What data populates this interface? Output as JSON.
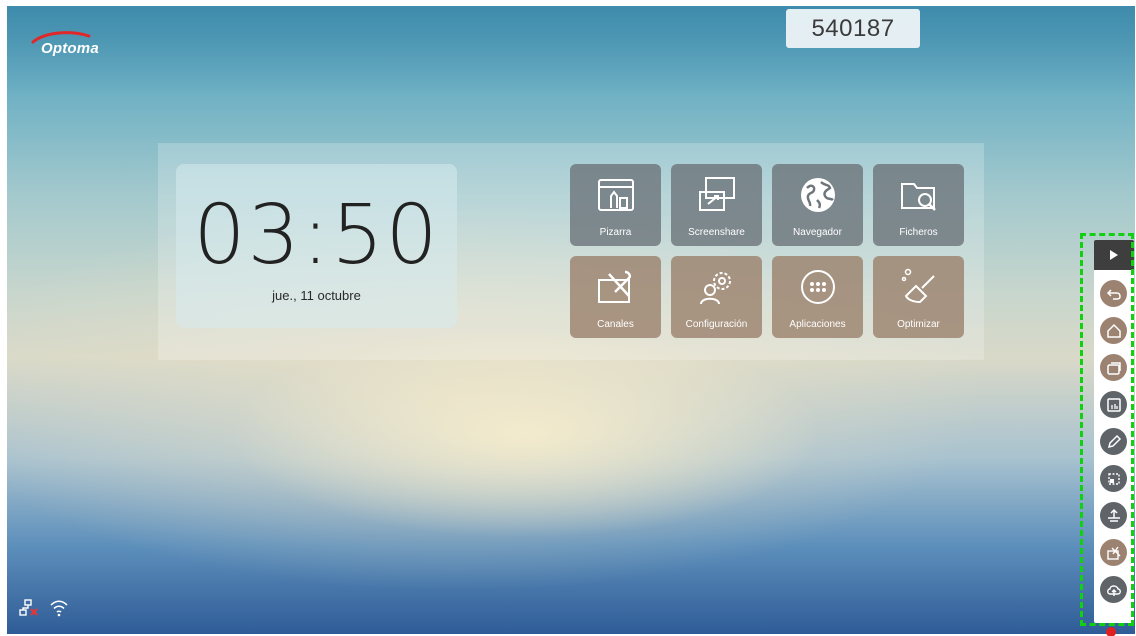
{
  "brand": {
    "name": "Optoma"
  },
  "pin": {
    "code": "540187"
  },
  "clock": {
    "time": "03:50",
    "date": "jue., 11 octubre"
  },
  "apps": [
    {
      "label": "Pizarra",
      "icon": "whiteboard-icon",
      "color": "gray"
    },
    {
      "label": "Screenshare",
      "icon": "screenshare-icon",
      "color": "gray"
    },
    {
      "label": "Navegador",
      "icon": "globe-icon",
      "color": "gray"
    },
    {
      "label": "Ficheros",
      "icon": "folder-search-icon",
      "color": "gray"
    },
    {
      "label": "Canales",
      "icon": "channels-tools-icon",
      "color": "brown"
    },
    {
      "label": "Configuración",
      "icon": "settings-gear-icon",
      "color": "brown"
    },
    {
      "label": "Aplicaciones",
      "icon": "apps-grid-icon",
      "color": "brown"
    },
    {
      "label": "Optimizar",
      "icon": "broom-clean-icon",
      "color": "brown"
    }
  ],
  "sidebar": {
    "toggle_icon": "play-triangle-icon",
    "items": [
      {
        "icon": "back-icon",
        "color": "brown"
      },
      {
        "icon": "home-icon",
        "color": "brown"
      },
      {
        "icon": "recent-windows-icon",
        "color": "brown"
      },
      {
        "icon": "whiteboard-small-icon",
        "color": "dark"
      },
      {
        "icon": "pen-annotate-icon",
        "color": "dark"
      },
      {
        "icon": "screenshot-crop-icon",
        "color": "dark"
      },
      {
        "icon": "freeze-icon",
        "color": "dark"
      },
      {
        "icon": "channels-small-icon",
        "color": "brown"
      },
      {
        "icon": "upload-cloud-icon",
        "color": "dark"
      }
    ]
  },
  "status": {
    "icons": [
      "ethernet-disconnected-icon",
      "wifi-icon"
    ]
  },
  "colors": {
    "tile_gray": "#6e767c",
    "tile_brown": "#9e8672",
    "highlight": "#10d010",
    "sidebar_dark": "#3e3e3e"
  }
}
